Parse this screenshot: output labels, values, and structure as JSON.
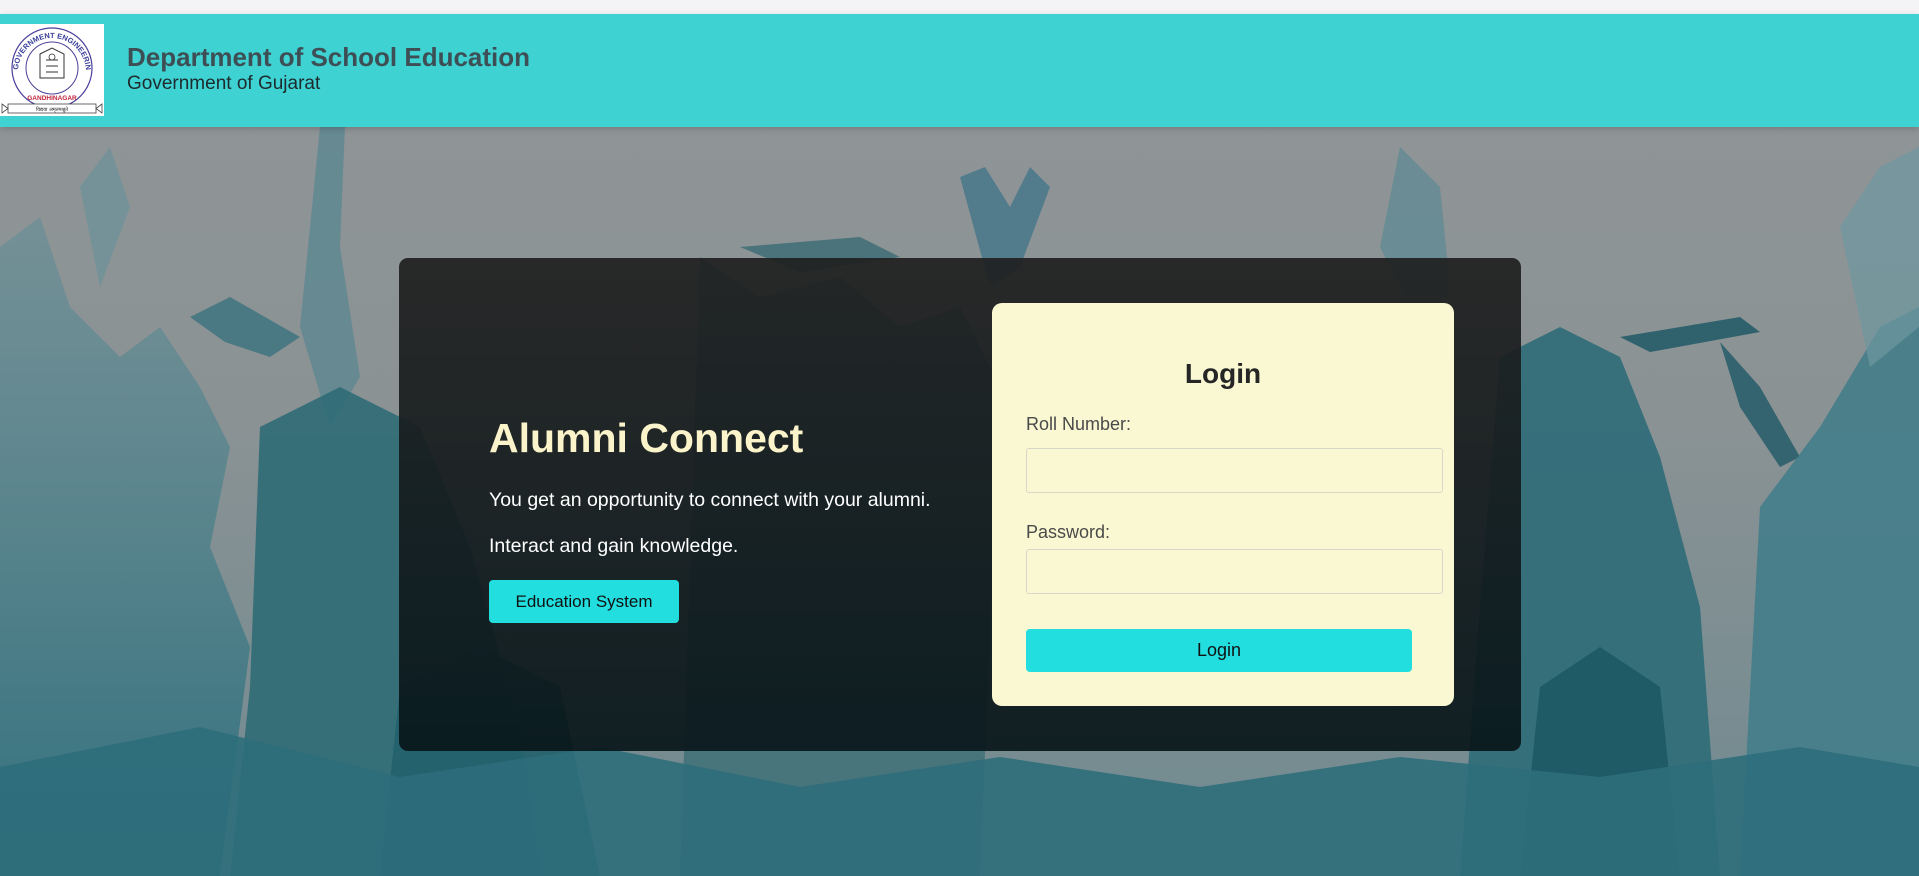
{
  "header": {
    "title": "Department of School Education",
    "subtitle": "Government of Gujarat",
    "logo": {
      "ring_text": "GOVERNMENT ENGINEERING COLLEGE",
      "city_text": "GANDHINAGAR",
      "motto_text": "विद्यया अमृतमश्नुते"
    }
  },
  "promo": {
    "title": "Alumni Connect",
    "line1": "You get an opportunity to connect with your alumni.",
    "line2": "Interact and gain knowledge.",
    "button_label": "Education System"
  },
  "login": {
    "heading": "Login",
    "roll_label": "Roll Number:",
    "roll_value": "",
    "password_label": "Password:",
    "password_value": "",
    "button_label": "Login"
  },
  "colors": {
    "header_bg": "#3fd2d2",
    "accent_button": "#22dede",
    "card_bg": "#f9f8d2",
    "title_cream": "#fbf3c9"
  }
}
